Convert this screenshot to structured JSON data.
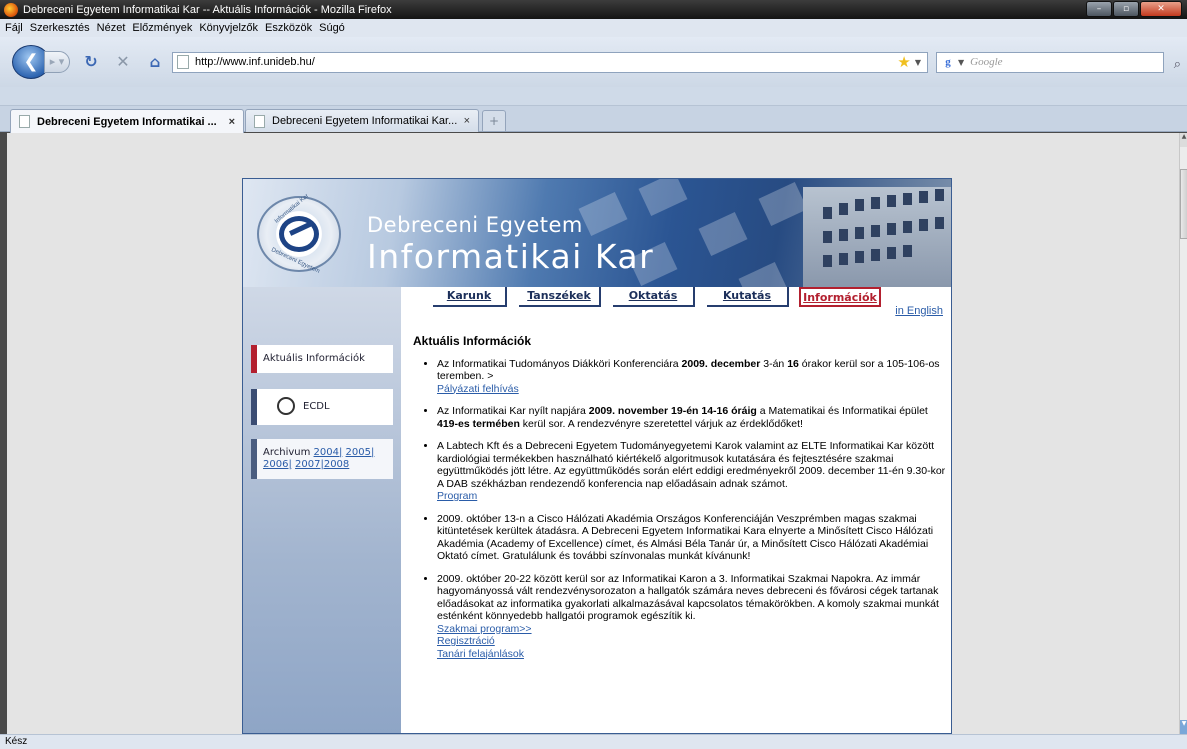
{
  "window": {
    "title": "Debreceni Egyetem Informatikai Kar -- Aktuális Információk - Mozilla Firefox",
    "minimize": "–",
    "maximize": "▫",
    "close": "✕"
  },
  "menubar": [
    "Fájl",
    "Szerkesztés",
    "Nézet",
    "Előzmények",
    "Könyvjelzők",
    "Eszközök",
    "Súgó"
  ],
  "navbar": {
    "url": "http://www.inf.unideb.hu/",
    "search_placeholder": "Google"
  },
  "tabs": [
    {
      "title": "Debreceni Egyetem Informatikai ...",
      "close": "×"
    },
    {
      "title": "Debreceni Egyetem Informatikai Kar...",
      "close": "×"
    }
  ],
  "newtab": "+",
  "page": {
    "banner": {
      "line1": "Debreceni Egyetem",
      "line2": "Informatikai Kar",
      "logo_text_1": "Informatikai Kar",
      "logo_text_2": "Debreceni Egyetem"
    },
    "menu": [
      "Karunk",
      "Tanszékek",
      "Oktatás",
      "Kutatás",
      "Információk"
    ],
    "english": "in English",
    "sidebar": {
      "current": "Aktuális Információk",
      "ecdl": "ECDL",
      "archive_label": "Archivum",
      "archive_years": [
        "2004|",
        "2005|",
        "2006|",
        "2007|2008"
      ]
    },
    "heading": "Aktuális Információk",
    "news": [
      {
        "parts": [
          "Az Informatikai Tudományos Diákköri Konferenciára ",
          "2009. december",
          " 3-án ",
          "16",
          " órakor kerül sor a 105-106-os teremben. >"
        ],
        "links": [
          "Pályázati felhívás"
        ]
      },
      {
        "parts": [
          "Az Informatikai Kar nyílt napjára ",
          "2009. november 19-én 14-16 óráig",
          " a Matematikai és Informatikai épület ",
          "419-es termében",
          " kerül sor. A rendezvényre szeretettel várjuk az érdeklődőket!"
        ],
        "links": []
      },
      {
        "parts": [
          "A Labtech Kft és a Debreceni Egyetem Tudományegyetemi Karok valamint az ELTE Informatikai Kar között kardiológiai termékekben használható kiértékelő algoritmusok kutatására és fejtesztésére szakmai együttműködés jött létre. Az együttműködés során elért eddigi eredményekről 2009. december 11-én 9.30-kor A DAB székházban rendezendő konferencia nap előadásain adnak számot."
        ],
        "links": [
          "Program"
        ]
      },
      {
        "parts": [
          "2009. október 13-n a Cisco Hálózati Akadémia Országos Konferenciáján Veszprémben magas szakmai kitüntetések kerültek átadásra. A Debreceni Egyetem Informatikai Kara elnyerte a Minősített Cisco Hálózati Akadémia (Academy of Excellence) címet, és Almási Béla Tanár úr, a Minősített Cisco Hálózati Akadémiai Oktató címet. Gratulálunk és további színvonalas munkát kívánunk!"
        ],
        "links": []
      },
      {
        "parts": [
          "2009. október 20-22 között kerül sor az Informatikai Karon a 3. Informatikai Szakmai Napokra. Az immár hagyományossá vált rendezvénysorozaton a hallgatók számára neves debreceni és fővárosi cégek tartanak előadásokat az informatika gyakorlati alkalmazásával kapcsolatos témakörökben. A komoly szakmai munkát esténként könnyedebb hallgatói programok egészítik ki."
        ],
        "links": [
          "Szakmai program>>",
          "Regisztráció",
          "Tanári felajánlások"
        ]
      }
    ]
  },
  "status": "Kész"
}
